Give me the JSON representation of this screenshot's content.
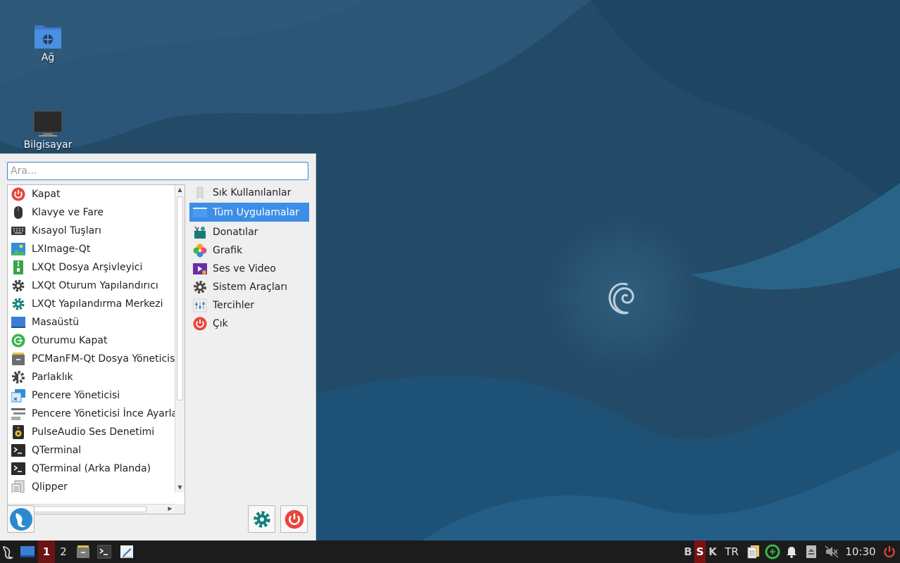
{
  "desktop": {
    "icons": [
      {
        "label": "Ağ",
        "icon": "network-folder-icon"
      },
      {
        "label": "Bilgisayar",
        "icon": "computer-icon"
      }
    ]
  },
  "menu": {
    "search": {
      "placeholder": "Ara...",
      "value": ""
    },
    "apps": [
      {
        "label": "Kapat",
        "icon": "power-icon"
      },
      {
        "label": "Klavye ve Fare",
        "icon": "mouse-icon"
      },
      {
        "label": "Kısayol Tuşları",
        "icon": "keyboard-icon"
      },
      {
        "label": "LXImage-Qt",
        "icon": "image-viewer-icon"
      },
      {
        "label": "LXQt Dosya Arşivleyici",
        "icon": "archive-icon"
      },
      {
        "label": "LXQt Oturum Yapılandırıcı",
        "icon": "gear-icon"
      },
      {
        "label": "LXQt Yapılandırma Merkezi",
        "icon": "config-center-icon"
      },
      {
        "label": "Masaüstü",
        "icon": "desktop-icon"
      },
      {
        "label": "Oturumu Kapat",
        "icon": "logout-icon"
      },
      {
        "label": "PCManFM-Qt Dosya Yöneticisi",
        "icon": "file-manager-icon"
      },
      {
        "label": "Parlaklık",
        "icon": "brightness-icon"
      },
      {
        "label": "Pencere Yöneticisi",
        "icon": "window-manager-icon"
      },
      {
        "label": "Pencere Yöneticisi İnce Ayarları",
        "icon": "window-tweaks-icon"
      },
      {
        "label": "PulseAudio Ses Denetimi",
        "icon": "speaker-icon"
      },
      {
        "label": "QTerminal",
        "icon": "terminal-icon"
      },
      {
        "label": "QTerminal (Arka Planda)",
        "icon": "terminal-drop-icon"
      },
      {
        "label": "Qlipper",
        "icon": "clipboard-icon"
      }
    ],
    "categories": [
      {
        "label": "Sık Kullanılanlar",
        "icon": "bookmark-icon"
      },
      {
        "label": "Tüm Uygulamalar",
        "icon": "all-apps-icon",
        "selected": true
      },
      {
        "label": "Donatılar",
        "icon": "accessories-icon"
      },
      {
        "label": "Grafik",
        "icon": "graphics-icon"
      },
      {
        "label": "Ses ve Video",
        "icon": "multimedia-icon"
      },
      {
        "label": "Sistem Araçları",
        "icon": "system-tools-icon"
      },
      {
        "label": "Tercihler",
        "icon": "preferences-icon"
      },
      {
        "label": "Çık",
        "icon": "exit-icon"
      }
    ]
  },
  "panel": {
    "desktops": [
      "1",
      "2"
    ],
    "active_desktop": "1",
    "keyboard_indicators": [
      "B",
      "S",
      "K"
    ],
    "keyboard_layout": "TR",
    "clock": "10:30"
  },
  "colors": {
    "accent": "#3d8ee6",
    "wallpaper_dark": "#1f4966",
    "panel_bg": "#1c1c1c",
    "active_desktop": "#6b1414",
    "power_red": "#e8453c"
  }
}
